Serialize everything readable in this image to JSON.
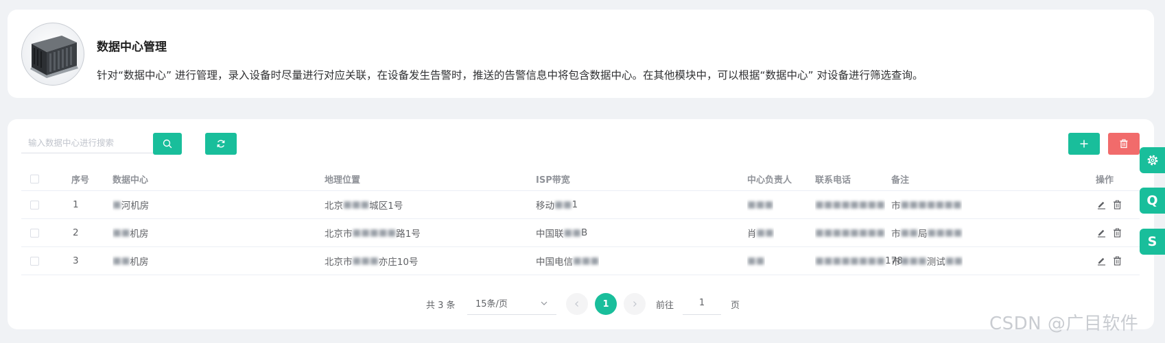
{
  "intro": {
    "title": "数据中心管理",
    "description": "针对“数据中心” 进行管理，录入设备时尽量进行对应关联，在设备发生告警时，推送的告警信息中将包含数据中心。在其他模块中，可以根据“数据中心” 对设备进行筛选查询。",
    "image_icon": "server-rack-image"
  },
  "toolbar": {
    "search_placeholder": "输入数据中心进行搜索",
    "search_icon": "search-icon",
    "refresh_icon": "refresh-icon",
    "add_icon": "plus-icon",
    "delete_icon": "trash-icon"
  },
  "table": {
    "headers": {
      "index": "序号",
      "name": "数据中心",
      "location": "地理位置",
      "isp": "ISP带宽",
      "owner": "中心负责人",
      "phone": "联系电话",
      "remark": "备注",
      "ops": "操作"
    },
    "rows": [
      {
        "index": "1",
        "name_a": "",
        "name_b": "河机房",
        "location_a": "北京",
        "location_b": "城区1号",
        "isp_a": "移动",
        "isp_b": "1",
        "owner_a": "",
        "owner_b": "",
        "phone_a": "",
        "phone_b": "",
        "remark_a": "市",
        "remark_b": ""
      },
      {
        "index": "2",
        "name_a": "",
        "name_b": "机房",
        "location_a": "北京市",
        "location_b": "路1号",
        "isp_a": "中国联",
        "isp_b": "B",
        "owner_a": "肖",
        "owner_b": "",
        "phone_a": "",
        "phone_b": "",
        "remark_a": "市",
        "remark_b": "局"
      },
      {
        "index": "3",
        "name_a": "",
        "name_b": "机房",
        "location_a": "北京市",
        "location_b": "亦庄10号",
        "isp_a": "中国电信",
        "isp_b": "",
        "owner_a": "",
        "owner_b": "",
        "phone_a": "",
        "phone_b": "178",
        "remark_a": "市",
        "remark_b": "测试"
      }
    ],
    "edit_icon": "pencil-icon",
    "row_delete_icon": "trash-icon"
  },
  "pagination": {
    "total": "共 3 条",
    "page_size": "15条/页",
    "current_page": "1",
    "goto_label": "前往",
    "goto_value": "1",
    "page_unit": "页"
  },
  "side_tools": {
    "settings_icon": "gear-icon",
    "q_label": "Q",
    "s_label": "S"
  },
  "watermark": "CSDN @广目软件",
  "colors": {
    "accent": "#19be9b",
    "danger": "#f16b6b",
    "background": "#f0f2f5"
  }
}
